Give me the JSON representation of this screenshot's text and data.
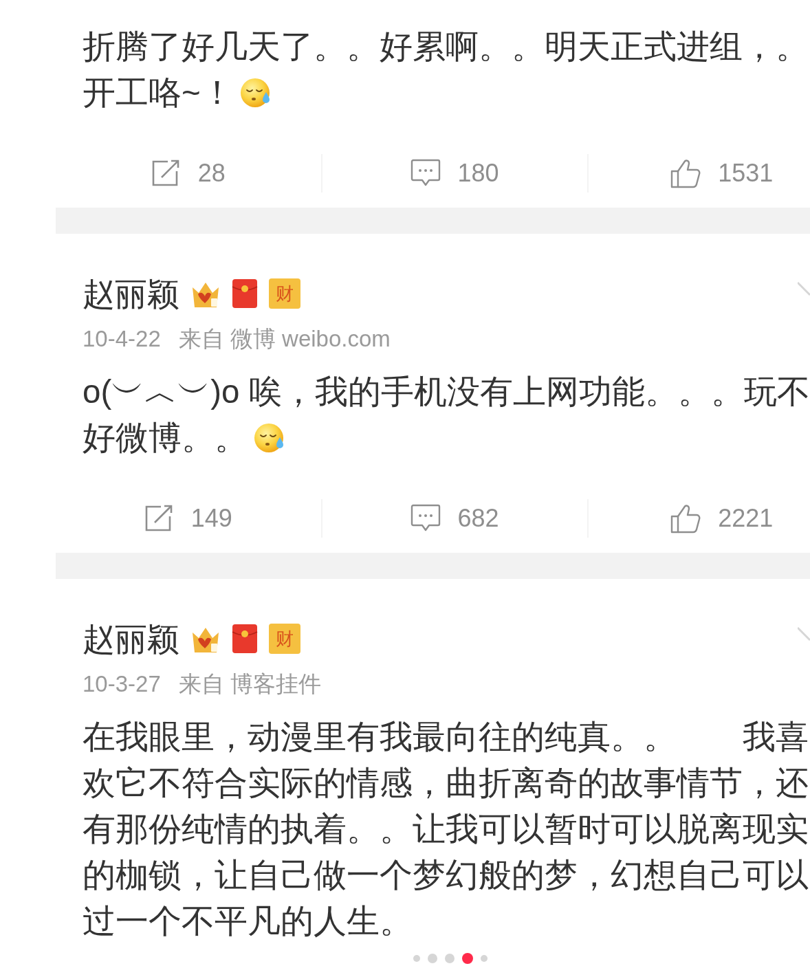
{
  "posts": [
    {
      "body": {
        "lines": [
          "折腾了好几天了。。好累啊。。明天正式进组，。",
          "开工咯~！"
        ],
        "emoji": true
      },
      "actions": [
        {
          "kind": "repost",
          "count": "28"
        },
        {
          "kind": "comment",
          "count": "180"
        },
        {
          "kind": "like",
          "count": "1531"
        }
      ]
    },
    {
      "author": {
        "name": "赵丽颖",
        "badges": [
          {
            "kind": "crown"
          },
          {
            "kind": "red_envelope"
          },
          {
            "kind": "label",
            "text": "财"
          }
        ]
      },
      "time": "10-4-22",
      "source": "来自 微博 weibo.com",
      "body": {
        "lines": [
          "o(︶︿︶)o 唉，我的手机没有上网功能。。。玩不",
          "好微博。。"
        ],
        "emoji": true
      },
      "actions": [
        {
          "kind": "repost",
          "count": "149"
        },
        {
          "kind": "comment",
          "count": "682"
        },
        {
          "kind": "like",
          "count": "2221"
        }
      ]
    },
    {
      "author": {
        "name": "赵丽颖",
        "badges": [
          {
            "kind": "crown"
          },
          {
            "kind": "red_envelope"
          },
          {
            "kind": "label",
            "text": "财"
          }
        ]
      },
      "time": "10-3-27",
      "source": "来自 博客挂件",
      "body": {
        "lines": [
          "在我眼里，动漫里有我最向往的纯真。。　　我喜",
          "欢它不符合实际的情感，曲折离奇的故事情节，还",
          "有那份纯情的执着。。让我可以暂时可以脱离现实",
          "的枷锁，让自己做一个梦幻般的梦，幻想自己可以",
          "过一个不平凡的人生。"
        ]
      }
    }
  ],
  "pager": [
    {
      "selected": false
    },
    {
      "selected": false
    },
    {
      "selected": false
    },
    {
      "selected": true
    },
    {
      "selected": false
    }
  ]
}
